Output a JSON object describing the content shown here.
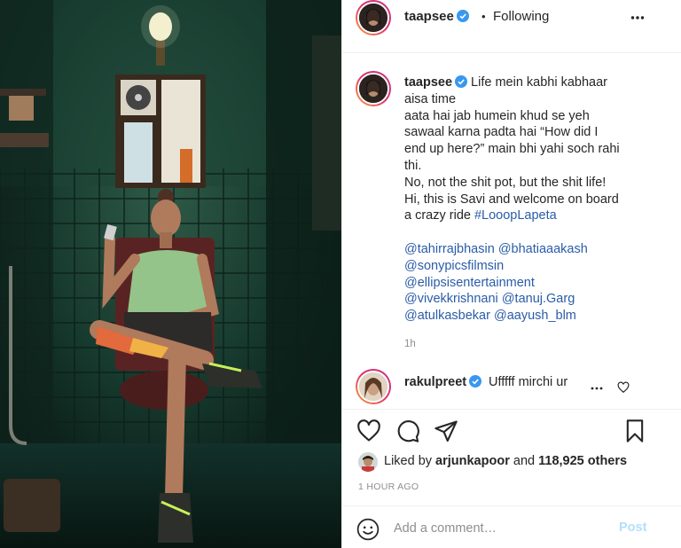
{
  "post": {
    "author": "taapsee",
    "header_separator": "•",
    "follow_status": "Following",
    "more_icon": "more-horizontal-icon",
    "verified_icon": "verified-badge-icon"
  },
  "caption": {
    "user": "taapsee",
    "lines": [
      "Life mein kabhi kabhaar",
      "aisa time",
      "aata hai jab humein khud se yeh",
      "sawaal karna padta hai “How did I",
      "end up here?” main bhi yahi soch rahi",
      "thi.",
      "No, not the shit pot, but the shit life!",
      "Hi, this is Savi and welcome on board",
      "a crazy ride"
    ],
    "hashtag": "#LooopLapeta",
    "mentions": [
      [
        "@tahirrajbhasin",
        "@bhatiaaakash"
      ],
      [
        "@sonypicsfilmsin"
      ],
      [
        "@ellipsisentertainment"
      ],
      [
        "@vivekkrishnani",
        "@tanuj.Garg"
      ],
      [
        "@atulkasbekar",
        "@aayush_blm"
      ]
    ],
    "time": "1h"
  },
  "comment": {
    "user": "rakulpreet",
    "text": "Ufffff mirchi ur"
  },
  "actions": {
    "like_icon": "heart-icon",
    "comment_icon": "comment-icon",
    "share_icon": "share-icon",
    "save_icon": "bookmark-icon"
  },
  "likes": {
    "prefix": "Liked by",
    "liker": "arjunkapoor",
    "middle": "and",
    "count": "118,925 others"
  },
  "posted_ago": "1 HOUR AGO",
  "add_comment": {
    "placeholder": "Add a comment…",
    "post_label": "Post",
    "emoji_icon": "smiley-icon"
  },
  "colors": {
    "link": "#2a5ca8",
    "post_disabled": "#b2dffc",
    "verified": "#3897f0",
    "muted": "#8e8e8e"
  }
}
